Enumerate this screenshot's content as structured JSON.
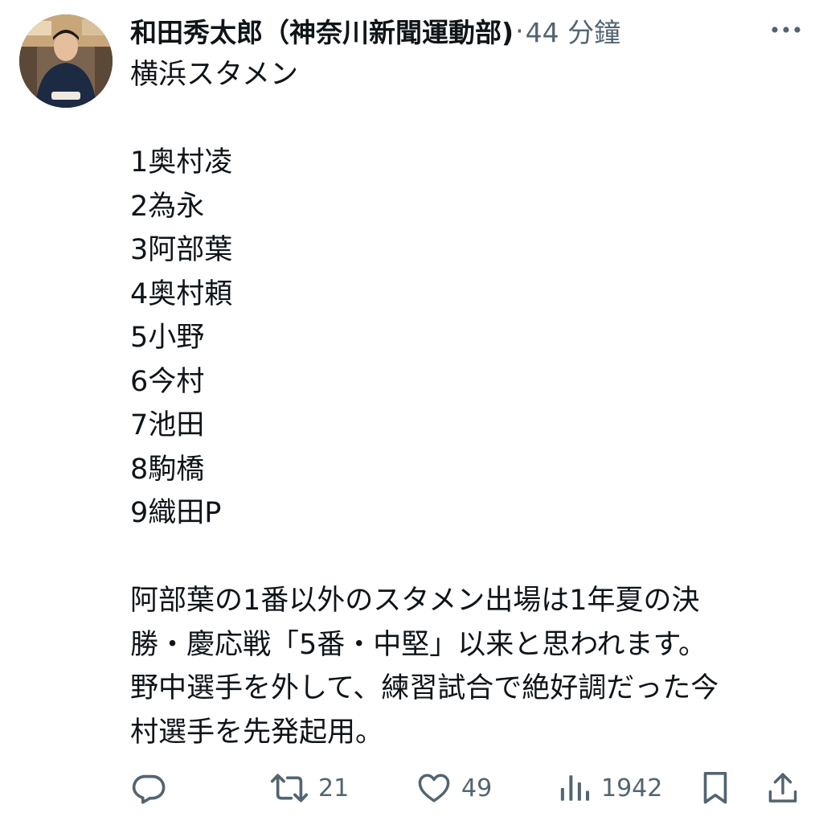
{
  "author": {
    "name": "和田秀太郎（神奈川新聞運動部)",
    "separator": "·",
    "time": "44 分鐘"
  },
  "post": {
    "text": "横浜スタメン\n\n1奥村凌\n2為永\n3阿部葉\n4奥村頼\n5小野\n6今村\n7池田\n8駒橋\n9織田P\n\n阿部葉の1番以外のスタメン出場は1年夏の決\n勝・慶応戦「5番・中堅」以来と思われます。\n野中選手を外して、練習試合で絶好調だった今\n村選手を先発起用。"
  },
  "actions": {
    "reply_icon": "reply-icon",
    "retweet_icon": "retweet-icon",
    "retweet_count": "21",
    "like_icon": "heart-icon",
    "like_count": "49",
    "views_icon": "views-bar-chart-icon",
    "views_count": "1942",
    "bookmark_icon": "bookmark-icon",
    "share_icon": "share-icon"
  },
  "colors": {
    "text_primary": "#0f1419",
    "text_secondary": "#536471",
    "background": "#ffffff"
  }
}
